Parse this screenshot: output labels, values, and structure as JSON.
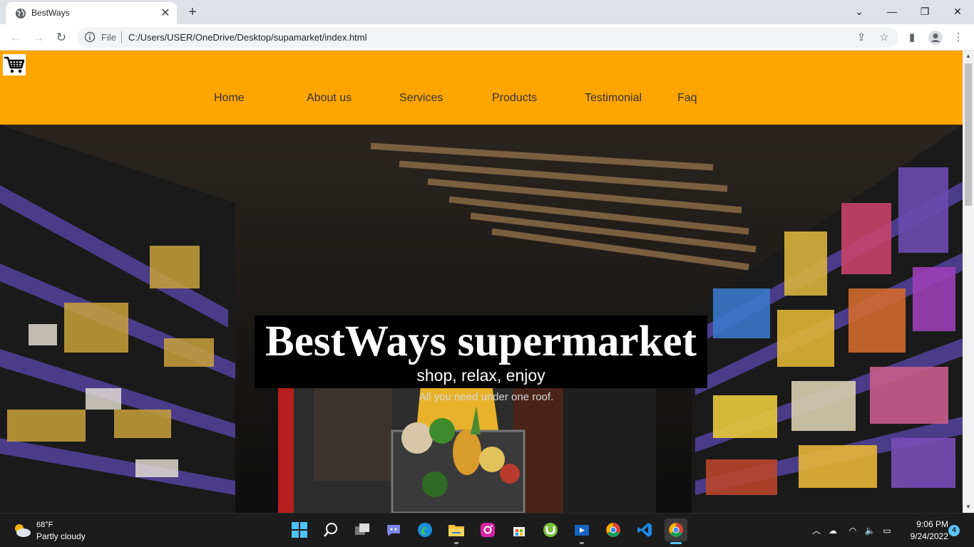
{
  "browser": {
    "tab_title": "BestWays",
    "url_scheme": "File",
    "url": "C:/Users/USER/OneDrive/Desktop/supamarket/index.html",
    "icons": [
      "globe-icon",
      "close-icon",
      "plus-icon",
      "back-icon",
      "forward-icon",
      "reload-icon",
      "info-icon",
      "share-icon",
      "star-icon",
      "sidebar-icon",
      "profile-icon",
      "menu-icon",
      "chevron-down-icon",
      "minimize-icon",
      "restore-icon",
      "window-close-icon"
    ]
  },
  "site": {
    "logo_icon": "shopping-cart-icon",
    "nav": [
      "Home",
      "About us",
      "Services",
      "Products",
      "Testimonial",
      "Faq"
    ],
    "hero": {
      "title": "BestWays supermarket",
      "subtitle": "shop, relax, enjoy",
      "tagline": "All you need under one roof."
    },
    "colors": {
      "header": "#ffa500",
      "title_box": "#000000"
    }
  },
  "taskbar": {
    "weather": {
      "temp": "68°F",
      "condition": "Partly cloudy"
    },
    "apps": [
      "windows-start-icon",
      "search-icon",
      "task-view-icon",
      "teams-chat-icon",
      "edge-icon",
      "file-explorer-icon",
      "instagram-icon",
      "store-icon",
      "utorrent-icon",
      "video-editor-icon",
      "chrome-icon",
      "vscode-icon",
      "chrome-active-icon"
    ],
    "time": "9:06 PM",
    "date": "9/24/2022",
    "notifications": "4"
  }
}
